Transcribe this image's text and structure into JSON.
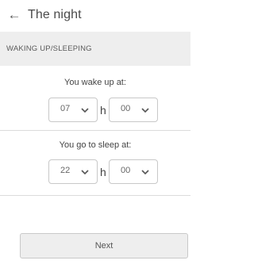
{
  "header": {
    "title": "The night"
  },
  "section": {
    "label": "WAKING UP/SLEEPING"
  },
  "wake": {
    "question": "You wake up at:",
    "hour": "07",
    "separator": "h",
    "minute": "00"
  },
  "sleep": {
    "question": "You go to sleep at:",
    "hour": "22",
    "separator": "h",
    "minute": "00"
  },
  "footer": {
    "next_label": "Next"
  },
  "icons": {
    "back": "arrow-left-icon",
    "dropdown": "chevron-down-icon"
  }
}
